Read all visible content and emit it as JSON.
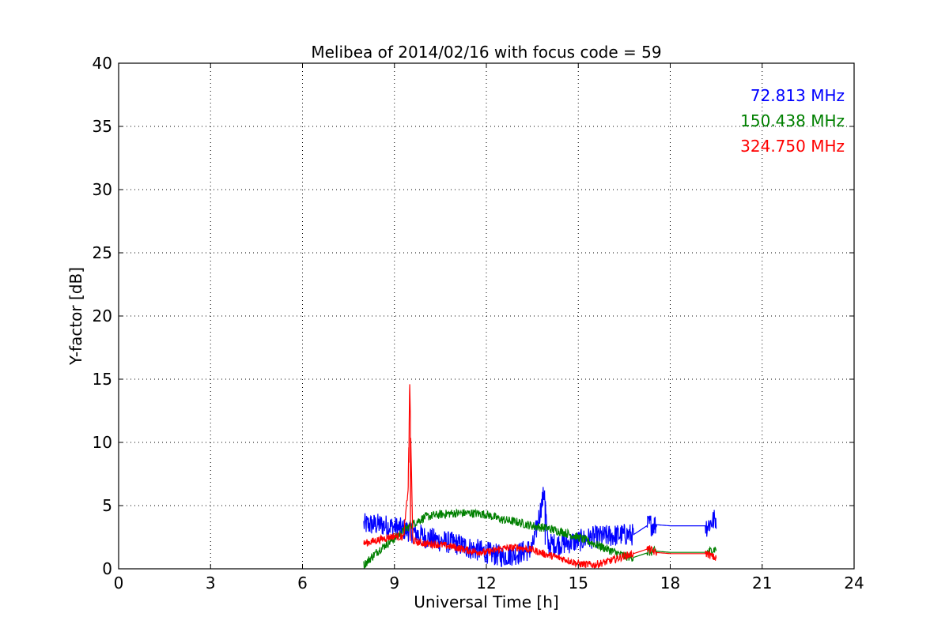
{
  "chart_data": {
    "type": "line",
    "title": "Melibea of 2014/02/16 with focus code = 59",
    "xlabel": "Universal Time [h]",
    "ylabel": "Y-factor [dB]",
    "xlim": [
      0,
      24
    ],
    "ylim": [
      0,
      40
    ],
    "xticks": [
      "0",
      "3",
      "6",
      "9",
      "12",
      "15",
      "18",
      "21",
      "24"
    ],
    "yticks": [
      "0",
      "5",
      "10",
      "15",
      "20",
      "25",
      "30",
      "35",
      "40"
    ],
    "grid": true,
    "legend_placement": "top-right",
    "series": [
      {
        "name": "72.813 MHz",
        "color": "#0000ff",
        "noise": 0.9,
        "x": [
          8.0,
          8.5,
          9.0,
          9.5,
          10.0,
          10.5,
          11.0,
          11.5,
          12.0,
          12.5,
          13.0,
          13.5,
          13.9,
          14.0,
          14.5,
          15.0,
          15.5,
          16.0,
          16.5,
          16.8,
          17.3,
          17.5,
          18.0,
          19.2,
          19.5
        ],
        "y": [
          3.5,
          3.5,
          3.3,
          3.0,
          2.5,
          2.2,
          2.0,
          1.6,
          1.3,
          1.0,
          1.2,
          1.6,
          6.2,
          1.9,
          2.0,
          2.2,
          2.5,
          2.6,
          2.7,
          2.7,
          3.5,
          3.5,
          3.4,
          3.4,
          4.0
        ]
      },
      {
        "name": "150.438 MHz",
        "color": "#008000",
        "noise": 0.35,
        "x": [
          8.0,
          8.5,
          9.0,
          9.5,
          10.0,
          10.5,
          11.0,
          11.5,
          12.0,
          12.5,
          13.0,
          13.5,
          14.0,
          14.5,
          15.0,
          15.5,
          16.0,
          16.5,
          16.8,
          17.3,
          17.5,
          18.0,
          19.2,
          19.5
        ],
        "y": [
          0.3,
          1.5,
          2.4,
          3.4,
          4.1,
          4.3,
          4.4,
          4.4,
          4.3,
          3.9,
          3.7,
          3.4,
          3.2,
          2.9,
          2.5,
          2.0,
          1.5,
          1.0,
          0.9,
          1.3,
          1.4,
          1.3,
          1.3,
          1.6
        ]
      },
      {
        "name": "324.750 MHz",
        "color": "#ff0000",
        "noise": 0.3,
        "x": [
          8.0,
          8.5,
          9.0,
          9.3,
          9.45,
          9.5,
          9.6,
          10.0,
          10.5,
          11.0,
          11.5,
          12.0,
          12.5,
          13.0,
          13.5,
          14.0,
          14.5,
          15.0,
          15.5,
          16.0,
          16.5,
          16.8,
          17.3,
          17.5,
          18.0,
          19.2,
          19.5
        ],
        "y": [
          2.0,
          2.3,
          2.6,
          2.5,
          6.5,
          14.6,
          2.2,
          2.0,
          1.9,
          1.7,
          1.4,
          1.3,
          1.6,
          1.7,
          1.5,
          1.1,
          0.8,
          0.4,
          0.3,
          0.6,
          1.0,
          1.2,
          1.6,
          1.3,
          1.2,
          1.2,
          0.8
        ]
      }
    ]
  }
}
